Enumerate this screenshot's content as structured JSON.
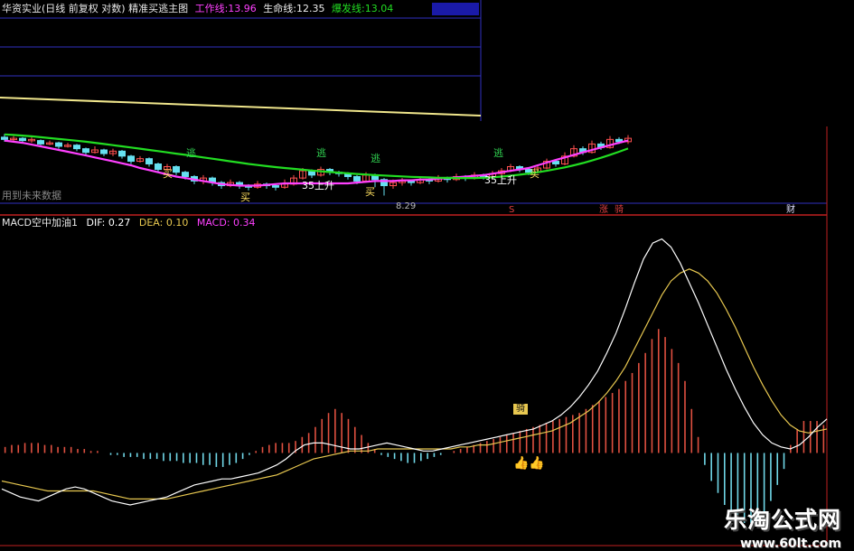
{
  "main": {
    "title": "华资实业(日线 前复权 对数)",
    "indicator_name": "精准买逃主图",
    "work_line_label": "工作线:",
    "work_line_value": "13.96",
    "life_line_label": "生命线:",
    "life_line_value": "12.35",
    "burst_line_label": "爆发线:",
    "burst_line_value": "13.04",
    "future_note": "用到未来数据",
    "low_label": "8.29",
    "signal_buy": "买",
    "signal_escape": "逃",
    "signal_up": "35上升",
    "badge_s": "S",
    "badge_rise": "涨",
    "badge_horse": "骑",
    "badge_wealth": "财"
  },
  "macd_panel": {
    "title": "MACD空中加油1",
    "dif_label": "DIF:",
    "dif_value": "0.27",
    "dea_label": "DEA:",
    "dea_value": "0.10",
    "macd_label": "MACD:",
    "macd_value": "0.34",
    "badge_text": "骑"
  },
  "watermark": {
    "title": "乐淘公式网",
    "url": "www.60lt.com"
  },
  "colors": {
    "work_line": "#ff40ff",
    "life_line": "#22dd22",
    "burst_line": "#f0e68c",
    "candle_up": "#ff5050",
    "candle_down": "#66e0f0",
    "dif": "#ffffff",
    "dea": "#e8c850",
    "macd_pos": "#e05040",
    "macd_neg": "#70d8e8",
    "grid": "#3030c0",
    "divider": "#c02020"
  },
  "chart_data": [
    {
      "type": "line",
      "name": "main",
      "bars": 70,
      "yscale": "log",
      "ylim": [
        8.0,
        16.0
      ],
      "series": [
        {
          "name": "工作线",
          "color": "#ff40ff",
          "values": [
            12.3,
            12.2,
            12.1,
            11.95,
            11.8,
            11.65,
            11.5,
            11.35,
            11.2,
            11.05,
            10.9,
            10.75,
            10.6,
            10.45,
            10.3,
            10.1,
            9.95,
            9.8,
            9.65,
            9.5,
            9.4,
            9.3,
            9.2,
            9.1,
            9.0,
            8.95,
            8.9,
            8.9,
            8.9,
            8.95,
            9.0,
            9.05,
            9.05,
            9.05,
            9.05,
            9.05,
            9.05,
            9.05,
            9.05,
            9.1,
            9.15,
            9.2,
            9.2,
            9.2,
            9.25,
            9.25,
            9.3,
            9.3,
            9.35,
            9.4,
            9.45,
            9.5,
            9.55,
            9.6,
            9.7,
            9.8,
            9.9,
            10.0,
            10.1,
            10.3,
            10.5,
            10.7,
            10.9,
            11.1,
            11.3,
            11.5,
            11.7,
            11.9,
            12.1,
            12.3
          ]
        },
        {
          "name": "生命线",
          "color": "#22dd22",
          "values": [
            12.85,
            12.8,
            12.75,
            12.68,
            12.6,
            12.52,
            12.44,
            12.36,
            12.28,
            12.2,
            12.1,
            12.0,
            11.9,
            11.8,
            11.7,
            11.6,
            11.5,
            11.4,
            11.3,
            11.2,
            11.1,
            11.0,
            10.9,
            10.8,
            10.7,
            10.6,
            10.5,
            10.4,
            10.32,
            10.24,
            10.17,
            10.1,
            10.04,
            9.98,
            9.92,
            9.87,
            9.82,
            9.77,
            9.72,
            9.68,
            9.64,
            9.6,
            9.57,
            9.54,
            9.51,
            9.48,
            9.46,
            9.44,
            9.42,
            9.41,
            9.4,
            9.4,
            9.4,
            9.42,
            9.45,
            9.5,
            9.56,
            9.63,
            9.71,
            9.8,
            9.9,
            10.02,
            10.15,
            10.3,
            10.47,
            10.66,
            10.87,
            11.1,
            11.35,
            11.62
          ]
        }
      ],
      "candles": [
        [
          12.6,
          12.4,
          12.9,
          12.2
        ],
        [
          12.4,
          12.5,
          12.7,
          12.2
        ],
        [
          12.5,
          12.3,
          12.6,
          12.1
        ],
        [
          12.3,
          12.4,
          12.6,
          12.1
        ],
        [
          12.3,
          12.0,
          12.4,
          11.9
        ],
        [
          12.0,
          12.1,
          12.3,
          11.9
        ],
        [
          12.1,
          11.8,
          12.2,
          11.6
        ],
        [
          11.8,
          11.9,
          12.1,
          11.7
        ],
        [
          11.9,
          11.6,
          12.0,
          11.4
        ],
        [
          11.6,
          11.3,
          11.7,
          11.1
        ],
        [
          11.3,
          11.5,
          11.8,
          11.2
        ],
        [
          11.5,
          11.2,
          11.6,
          11.0
        ],
        [
          11.2,
          11.4,
          11.6,
          11.0
        ],
        [
          11.4,
          11.0,
          11.5,
          10.8
        ],
        [
          11.0,
          10.6,
          11.1,
          10.4
        ],
        [
          10.6,
          10.8,
          11.0,
          10.5
        ],
        [
          10.8,
          10.4,
          10.9,
          10.2
        ],
        [
          10.4,
          10.0,
          10.5,
          9.8
        ],
        [
          10.0,
          10.2,
          10.4,
          9.9
        ],
        [
          10.2,
          9.8,
          10.3,
          9.6
        ],
        [
          9.8,
          9.5,
          9.9,
          9.3
        ],
        [
          9.5,
          9.2,
          9.6,
          9.0
        ],
        [
          9.2,
          9.4,
          9.6,
          9.0
        ],
        [
          9.4,
          9.1,
          9.5,
          8.9
        ],
        [
          9.1,
          8.9,
          9.2,
          8.7
        ],
        [
          8.9,
          9.1,
          9.3,
          8.8
        ],
        [
          9.1,
          8.9,
          9.2,
          8.7
        ],
        [
          8.9,
          8.8,
          9.0,
          8.6
        ],
        [
          8.8,
          9.0,
          9.2,
          8.7
        ],
        [
          9.0,
          8.9,
          9.1,
          8.7
        ],
        [
          8.9,
          8.8,
          9.0,
          8.6
        ],
        [
          8.8,
          9.0,
          9.3,
          8.7
        ],
        [
          9.0,
          9.4,
          9.6,
          8.9
        ],
        [
          9.4,
          9.9,
          10.1,
          9.3
        ],
        [
          9.9,
          9.6,
          10.0,
          9.4
        ],
        [
          9.6,
          10.0,
          10.2,
          9.5
        ],
        [
          10.0,
          9.8,
          10.1,
          9.6
        ],
        [
          9.8,
          9.7,
          9.9,
          9.5
        ],
        [
          9.7,
          9.5,
          9.8,
          9.3
        ],
        [
          9.5,
          9.2,
          9.6,
          9.0
        ],
        [
          9.2,
          9.6,
          9.8,
          9.1
        ],
        [
          9.6,
          9.3,
          9.7,
          8.8
        ],
        [
          9.3,
          8.9,
          9.4,
          8.29
        ],
        [
          8.9,
          9.1,
          9.3,
          8.7
        ],
        [
          9.1,
          9.2,
          9.4,
          8.9
        ],
        [
          9.2,
          9.1,
          9.3,
          8.9
        ],
        [
          9.1,
          9.3,
          9.5,
          9.0
        ],
        [
          9.3,
          9.2,
          9.4,
          9.0
        ],
        [
          9.2,
          9.4,
          9.6,
          9.1
        ],
        [
          9.4,
          9.3,
          9.5,
          9.1
        ],
        [
          9.3,
          9.5,
          9.7,
          9.2
        ],
        [
          9.5,
          9.4,
          9.6,
          9.2
        ],
        [
          9.4,
          9.6,
          9.8,
          9.3
        ],
        [
          9.6,
          9.5,
          9.7,
          9.3
        ],
        [
          9.5,
          9.7,
          9.9,
          9.4
        ],
        [
          9.7,
          9.9,
          10.1,
          9.6
        ],
        [
          9.9,
          10.2,
          10.4,
          9.8
        ],
        [
          10.2,
          10.0,
          10.3,
          9.8
        ],
        [
          10.0,
          9.8,
          10.1,
          9.6
        ],
        [
          9.8,
          10.1,
          10.3,
          9.7
        ],
        [
          10.1,
          10.6,
          10.8,
          10.0
        ],
        [
          10.6,
          10.4,
          10.7,
          10.2
        ],
        [
          10.4,
          11.0,
          11.3,
          10.3
        ],
        [
          11.0,
          11.6,
          11.9,
          10.9
        ],
        [
          11.6,
          11.3,
          11.8,
          11.1
        ],
        [
          11.3,
          12.0,
          12.3,
          11.2
        ],
        [
          12.0,
          11.7,
          12.2,
          11.5
        ],
        [
          11.7,
          12.4,
          12.7,
          11.6
        ],
        [
          12.4,
          12.2,
          12.6,
          12.0
        ],
        [
          12.2,
          12.5,
          12.8,
          12.0
        ]
      ]
    },
    {
      "type": "bar",
      "name": "macd",
      "ylim": [
        -0.4,
        1.1
      ],
      "series": [
        {
          "name": "DIF",
          "color": "#ffffff"
        },
        {
          "name": "DEA",
          "color": "#e8c850"
        },
        {
          "name": "MACD",
          "color": "#e05040"
        }
      ],
      "bars": 120,
      "macd_values": [
        0.03,
        0.04,
        0.04,
        0.05,
        0.05,
        0.05,
        0.04,
        0.04,
        0.03,
        0.03,
        0.03,
        0.02,
        0.02,
        0.01,
        0.01,
        0.0,
        -0.01,
        -0.01,
        -0.02,
        -0.02,
        -0.02,
        -0.03,
        -0.03,
        -0.03,
        -0.04,
        -0.04,
        -0.04,
        -0.05,
        -0.05,
        -0.05,
        -0.06,
        -0.06,
        -0.07,
        -0.07,
        -0.06,
        -0.05,
        -0.03,
        -0.01,
        0.01,
        0.03,
        0.04,
        0.05,
        0.05,
        0.05,
        0.06,
        0.08,
        0.1,
        0.13,
        0.17,
        0.2,
        0.22,
        0.2,
        0.17,
        0.13,
        0.09,
        0.05,
        0.02,
        -0.01,
        -0.02,
        -0.03,
        -0.04,
        -0.05,
        -0.05,
        -0.04,
        -0.03,
        -0.02,
        -0.01,
        0.0,
        0.01,
        0.02,
        0.03,
        0.04,
        0.05,
        0.06,
        0.07,
        0.08,
        0.09,
        0.1,
        0.11,
        0.12,
        0.13,
        0.14,
        0.15,
        0.16,
        0.17,
        0.18,
        0.19,
        0.2,
        0.22,
        0.24,
        0.26,
        0.28,
        0.3,
        0.32,
        0.36,
        0.4,
        0.45,
        0.5,
        0.57,
        0.62,
        0.58,
        0.52,
        0.45,
        0.36,
        0.22,
        0.08,
        -0.06,
        -0.14,
        -0.2,
        -0.26,
        -0.3,
        -0.34,
        -0.35,
        -0.35,
        -0.34,
        -0.3,
        -0.24,
        -0.16,
        -0.08,
        0.04,
        0.12,
        0.16,
        0.16,
        0.16,
        0.14
      ],
      "dif": [
        -0.18,
        -0.2,
        -0.22,
        -0.23,
        -0.24,
        -0.22,
        -0.2,
        -0.18,
        -0.17,
        -0.18,
        -0.2,
        -0.22,
        -0.24,
        -0.25,
        -0.26,
        -0.25,
        -0.24,
        -0.23,
        -0.22,
        -0.2,
        -0.18,
        -0.16,
        -0.15,
        -0.14,
        -0.13,
        -0.13,
        -0.12,
        -0.11,
        -0.1,
        -0.08,
        -0.06,
        -0.03,
        0.01,
        0.04,
        0.05,
        0.05,
        0.04,
        0.03,
        0.02,
        0.02,
        0.03,
        0.04,
        0.05,
        0.04,
        0.03,
        0.02,
        0.01,
        0.01,
        0.02,
        0.03,
        0.04,
        0.05,
        0.06,
        0.07,
        0.08,
        0.09,
        0.1,
        0.11,
        0.12,
        0.14,
        0.16,
        0.19,
        0.23,
        0.28,
        0.34,
        0.41,
        0.5,
        0.6,
        0.72,
        0.85,
        0.97,
        1.05,
        1.07,
        1.03,
        0.95,
        0.85,
        0.75,
        0.64,
        0.53,
        0.42,
        0.32,
        0.23,
        0.15,
        0.09,
        0.05,
        0.03,
        0.02,
        0.04,
        0.08,
        0.13,
        0.17
      ],
      "dea": [
        -0.14,
        -0.15,
        -0.16,
        -0.17,
        -0.18,
        -0.19,
        -0.19,
        -0.19,
        -0.19,
        -0.19,
        -0.19,
        -0.2,
        -0.21,
        -0.22,
        -0.23,
        -0.23,
        -0.23,
        -0.23,
        -0.23,
        -0.22,
        -0.21,
        -0.2,
        -0.19,
        -0.18,
        -0.17,
        -0.16,
        -0.15,
        -0.14,
        -0.13,
        -0.12,
        -0.11,
        -0.09,
        -0.07,
        -0.05,
        -0.03,
        -0.02,
        -0.01,
        0.0,
        0.01,
        0.01,
        0.01,
        0.02,
        0.02,
        0.02,
        0.02,
        0.02,
        0.02,
        0.02,
        0.02,
        0.02,
        0.03,
        0.03,
        0.04,
        0.04,
        0.05,
        0.06,
        0.07,
        0.08,
        0.09,
        0.1,
        0.11,
        0.13,
        0.15,
        0.18,
        0.21,
        0.25,
        0.3,
        0.36,
        0.43,
        0.52,
        0.61,
        0.7,
        0.79,
        0.86,
        0.9,
        0.92,
        0.9,
        0.86,
        0.8,
        0.72,
        0.63,
        0.53,
        0.43,
        0.34,
        0.26,
        0.19,
        0.14,
        0.11,
        0.1,
        0.11,
        0.12
      ]
    }
  ]
}
